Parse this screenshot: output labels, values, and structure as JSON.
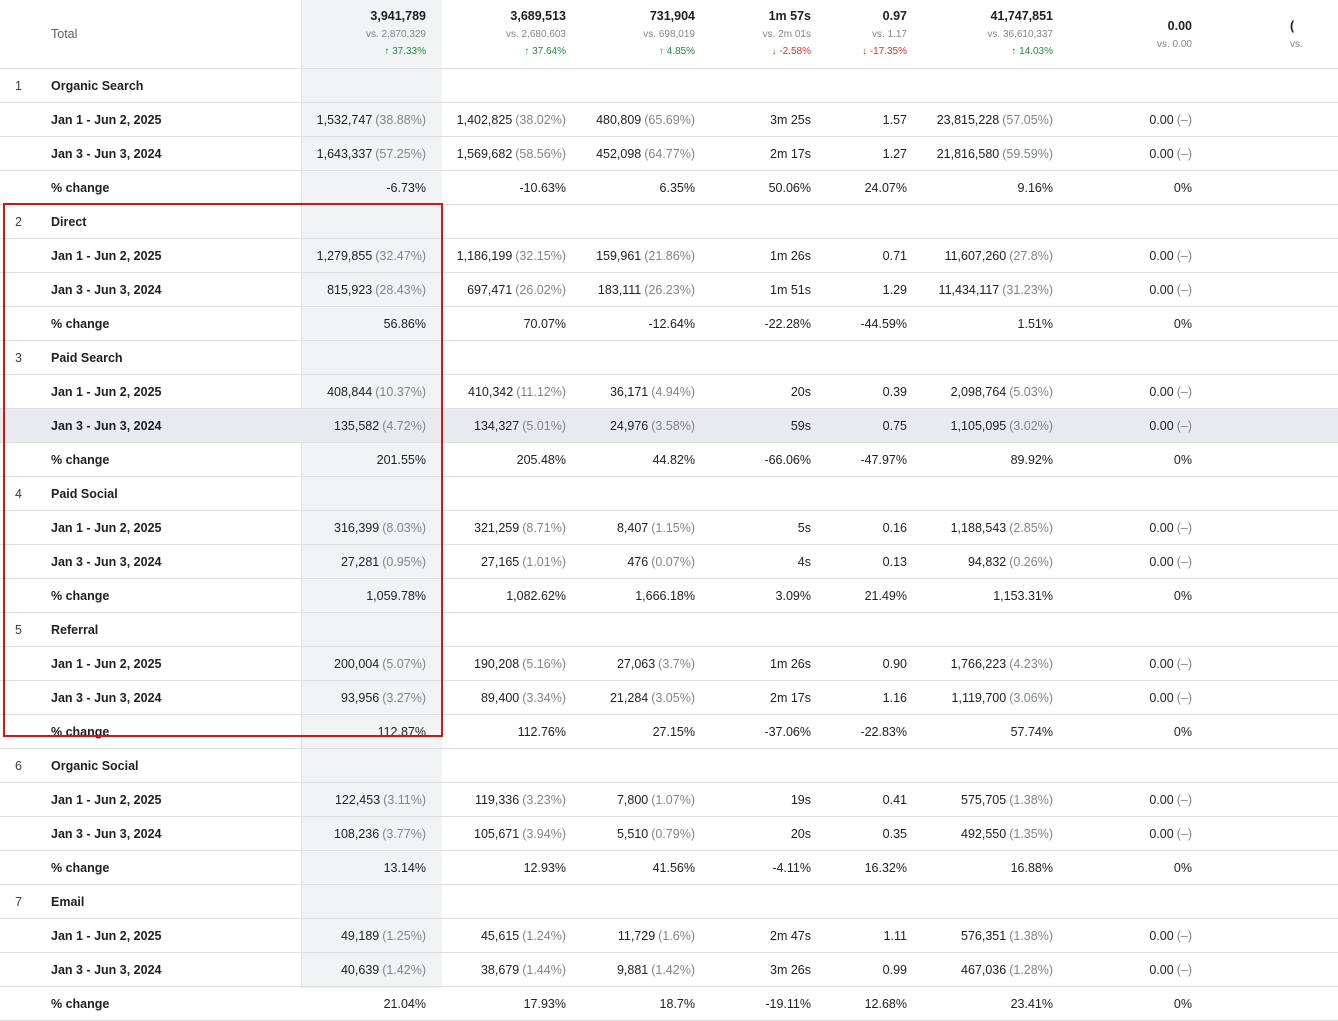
{
  "totals": {
    "label": "Total",
    "users": {
      "value": "3,941,789",
      "vs": "vs. 2,870,329",
      "delta": "↑ 37.33%",
      "dir": "up"
    },
    "new_users": {
      "value": "3,689,513",
      "vs": "vs. 2,680,603",
      "delta": "↑ 37.64%",
      "dir": "up"
    },
    "engaged": {
      "value": "731,904",
      "vs": "vs. 698,019",
      "delta": "↑ 4.85%",
      "dir": "up"
    },
    "avg_time": {
      "value": "1m 57s",
      "vs": "vs. 2m 01s",
      "delta": "↓ -2.58%",
      "dir": "down"
    },
    "spu": {
      "value": "0.97",
      "vs": "vs. 1.17",
      "delta": "↓ -17.35%",
      "dir": "down"
    },
    "events": {
      "value": "41,747,851",
      "vs": "vs. 36,610,337",
      "delta": "↑ 14.03%",
      "dir": "up"
    },
    "conversions": {
      "value": "0.00",
      "vs": "vs. 0.00"
    },
    "revenue": {
      "value": "(",
      "vs": "vs."
    }
  },
  "rows": [
    {
      "type": "group",
      "idx": "1",
      "name": "Organic Search"
    },
    {
      "type": "sub",
      "name": "Jan 1 - Jun 2, 2025",
      "users": "1,532,747",
      "users_pct": "(38.88%)",
      "new": "1,402,825",
      "new_pct": "(38.02%)",
      "eng": "480,809",
      "eng_pct": "(65.69%)",
      "time": "3m 25s",
      "spu": "1.57",
      "events": "23,815,228",
      "events_pct": "(57.05%)",
      "conv": "0.00",
      "conv_pct": "(–)"
    },
    {
      "type": "sub",
      "name": "Jan 3 - Jun 3, 2024",
      "users": "1,643,337",
      "users_pct": "(57.25%)",
      "new": "1,569,682",
      "new_pct": "(58.56%)",
      "eng": "452,098",
      "eng_pct": "(64.77%)",
      "time": "2m 17s",
      "spu": "1.27",
      "events": "21,816,580",
      "events_pct": "(59.59%)",
      "conv": "0.00",
      "conv_pct": "(–)"
    },
    {
      "type": "sub",
      "name": "% change",
      "users": "-6.73%",
      "new": "-10.63%",
      "eng": "6.35%",
      "time": "50.06%",
      "spu": "24.07%",
      "events": "9.16%",
      "conv": "0%"
    },
    {
      "type": "group",
      "idx": "2",
      "name": "Direct"
    },
    {
      "type": "sub",
      "name": "Jan 1 - Jun 2, 2025",
      "users": "1,279,855",
      "users_pct": "(32.47%)",
      "new": "1,186,199",
      "new_pct": "(32.15%)",
      "eng": "159,961",
      "eng_pct": "(21.86%)",
      "time": "1m 26s",
      "spu": "0.71",
      "events": "11,607,260",
      "events_pct": "(27.8%)",
      "conv": "0.00",
      "conv_pct": "(–)"
    },
    {
      "type": "sub",
      "name": "Jan 3 - Jun 3, 2024",
      "users": "815,923",
      "users_pct": "(28.43%)",
      "new": "697,471",
      "new_pct": "(26.02%)",
      "eng": "183,111",
      "eng_pct": "(26.23%)",
      "time": "1m 51s",
      "spu": "1.29",
      "events": "11,434,117",
      "events_pct": "(31.23%)",
      "conv": "0.00",
      "conv_pct": "(–)"
    },
    {
      "type": "sub",
      "name": "% change",
      "users": "56.86%",
      "new": "70.07%",
      "eng": "-12.64%",
      "time": "-22.28%",
      "spu": "-44.59%",
      "events": "1.51%",
      "conv": "0%"
    },
    {
      "type": "group",
      "idx": "3",
      "name": "Paid Search"
    },
    {
      "type": "sub",
      "name": "Jan 1 - Jun 2, 2025",
      "users": "408,844",
      "users_pct": "(10.37%)",
      "new": "410,342",
      "new_pct": "(11.12%)",
      "eng": "36,171",
      "eng_pct": "(4.94%)",
      "time": "20s",
      "spu": "0.39",
      "events": "2,098,764",
      "events_pct": "(5.03%)",
      "conv": "0.00",
      "conv_pct": "(–)"
    },
    {
      "type": "sub",
      "hl": true,
      "name": "Jan 3 - Jun 3, 2024",
      "users": "135,582",
      "users_pct": "(4.72%)",
      "new": "134,327",
      "new_pct": "(5.01%)",
      "eng": "24,976",
      "eng_pct": "(3.58%)",
      "time": "59s",
      "spu": "0.75",
      "events": "1,105,095",
      "events_pct": "(3.02%)",
      "conv": "0.00",
      "conv_pct": "(–)"
    },
    {
      "type": "sub",
      "name": "% change",
      "users": "201.55%",
      "new": "205.48%",
      "eng": "44.82%",
      "time": "-66.06%",
      "spu": "-47.97%",
      "events": "89.92%",
      "conv": "0%"
    },
    {
      "type": "group",
      "idx": "4",
      "name": "Paid Social"
    },
    {
      "type": "sub",
      "name": "Jan 1 - Jun 2, 2025",
      "users": "316,399",
      "users_pct": "(8.03%)",
      "new": "321,259",
      "new_pct": "(8.71%)",
      "eng": "8,407",
      "eng_pct": "(1.15%)",
      "time": "5s",
      "spu": "0.16",
      "events": "1,188,543",
      "events_pct": "(2.85%)",
      "conv": "0.00",
      "conv_pct": "(–)"
    },
    {
      "type": "sub",
      "name": "Jan 3 - Jun 3, 2024",
      "users": "27,281",
      "users_pct": "(0.95%)",
      "new": "27,165",
      "new_pct": "(1.01%)",
      "eng": "476",
      "eng_pct": "(0.07%)",
      "time": "4s",
      "spu": "0.13",
      "events": "94,832",
      "events_pct": "(0.26%)",
      "conv": "0.00",
      "conv_pct": "(–)"
    },
    {
      "type": "sub",
      "name": "% change",
      "users": "1,059.78%",
      "new": "1,082.62%",
      "eng": "1,666.18%",
      "time": "3.09%",
      "spu": "21.49%",
      "events": "1,153.31%",
      "conv": "0%"
    },
    {
      "type": "group",
      "idx": "5",
      "name": "Referral"
    },
    {
      "type": "sub",
      "name": "Jan 1 - Jun 2, 2025",
      "users": "200,004",
      "users_pct": "(5.07%)",
      "new": "190,208",
      "new_pct": "(5.16%)",
      "eng": "27,063",
      "eng_pct": "(3.7%)",
      "time": "1m 26s",
      "spu": "0.90",
      "events": "1,766,223",
      "events_pct": "(4.23%)",
      "conv": "0.00",
      "conv_pct": "(–)"
    },
    {
      "type": "sub",
      "name": "Jan 3 - Jun 3, 2024",
      "users": "93,956",
      "users_pct": "(3.27%)",
      "new": "89,400",
      "new_pct": "(3.34%)",
      "eng": "21,284",
      "eng_pct": "(3.05%)",
      "time": "2m 17s",
      "spu": "1.16",
      "events": "1,119,700",
      "events_pct": "(3.06%)",
      "conv": "0.00",
      "conv_pct": "(–)"
    },
    {
      "type": "sub",
      "name": "% change",
      "users": "112.87%",
      "new": "112.76%",
      "eng": "27.15%",
      "time": "-37.06%",
      "spu": "-22.83%",
      "events": "57.74%",
      "conv": "0%"
    },
    {
      "type": "group",
      "idx": "6",
      "name": "Organic Social"
    },
    {
      "type": "sub",
      "name": "Jan 1 - Jun 2, 2025",
      "users": "122,453",
      "users_pct": "(3.11%)",
      "new": "119,336",
      "new_pct": "(3.23%)",
      "eng": "7,800",
      "eng_pct": "(1.07%)",
      "time": "19s",
      "spu": "0.41",
      "events": "575,705",
      "events_pct": "(1.38%)",
      "conv": "0.00",
      "conv_pct": "(–)"
    },
    {
      "type": "sub",
      "name": "Jan 3 - Jun 3, 2024",
      "users": "108,236",
      "users_pct": "(3.77%)",
      "new": "105,671",
      "new_pct": "(3.94%)",
      "eng": "5,510",
      "eng_pct": "(0.79%)",
      "time": "20s",
      "spu": "0.35",
      "events": "492,550",
      "events_pct": "(1.35%)",
      "conv": "0.00",
      "conv_pct": "(–)"
    },
    {
      "type": "sub",
      "name": "% change",
      "users": "13.14%",
      "new": "12.93%",
      "eng": "41.56%",
      "time": "-4.11%",
      "spu": "16.32%",
      "events": "16.88%",
      "conv": "0%"
    },
    {
      "type": "group",
      "idx": "7",
      "name": "Email"
    },
    {
      "type": "sub",
      "name": "Jan 1 - Jun 2, 2025",
      "users": "49,189",
      "users_pct": "(1.25%)",
      "new": "45,615",
      "new_pct": "(1.24%)",
      "eng": "11,729",
      "eng_pct": "(1.6%)",
      "time": "2m 47s",
      "spu": "1.11",
      "events": "576,351",
      "events_pct": "(1.38%)",
      "conv": "0.00",
      "conv_pct": "(–)"
    },
    {
      "type": "sub",
      "name": "Jan 3 - Jun 3, 2024",
      "users": "40,639",
      "users_pct": "(1.42%)",
      "new": "38,679",
      "new_pct": "(1.44%)",
      "eng": "9,881",
      "eng_pct": "(1.42%)",
      "time": "3m 26s",
      "spu": "0.99",
      "events": "467,036",
      "events_pct": "(1.28%)",
      "conv": "0.00",
      "conv_pct": "(–)"
    },
    {
      "type": "sub",
      "name": "% change",
      "users": "21.04%",
      "new": "17.93%",
      "eng": "18.7%",
      "time": "-19.11%",
      "spu": "12.68%",
      "events": "23.41%",
      "conv": "0%"
    }
  ],
  "colors": {
    "up": "#1e8e3e",
    "down": "#d93025",
    "highlight_box": "#e01010",
    "shaded_column": "#f1f3f4"
  }
}
